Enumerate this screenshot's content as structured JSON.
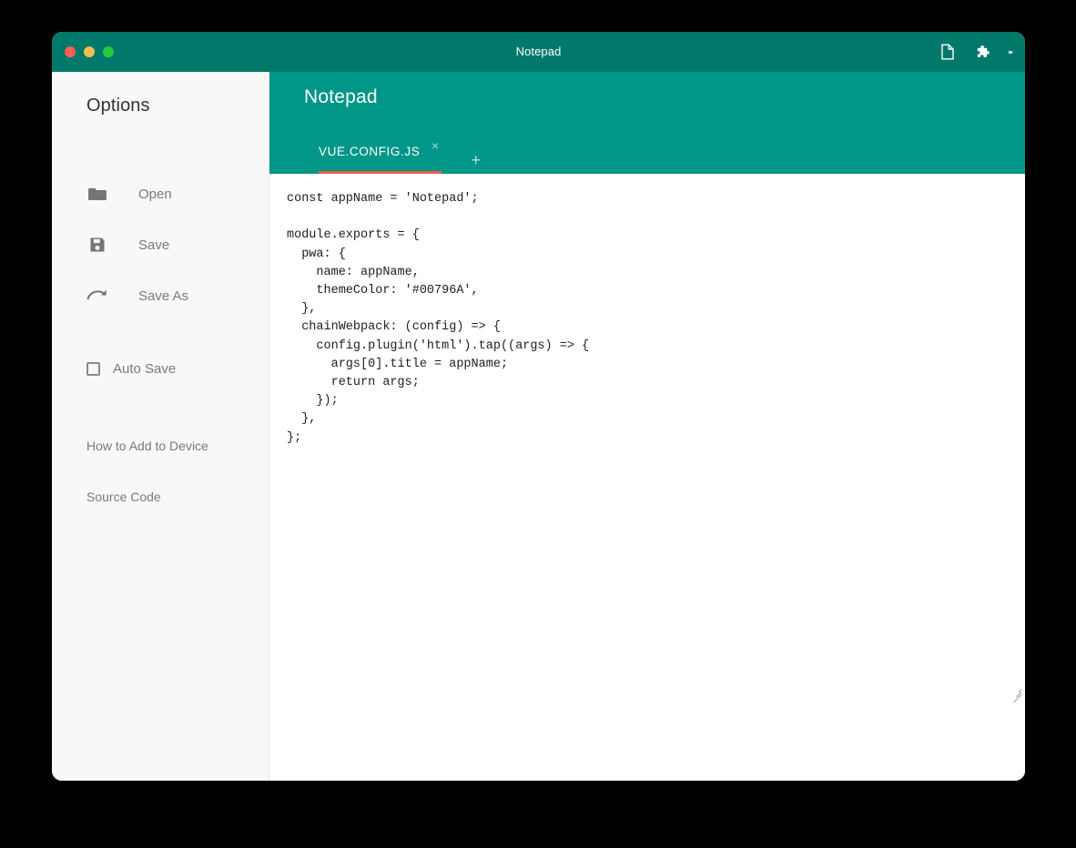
{
  "window": {
    "title": "Notepad",
    "controls": [
      {
        "name": "close",
        "color": "#ff5f56"
      },
      {
        "name": "minimize",
        "color": "#f4bd4f"
      },
      {
        "name": "maximize",
        "color": "#27c93f"
      }
    ],
    "actions": [
      {
        "icon": "page-icon",
        "label": "New page"
      },
      {
        "icon": "puzzle-piece-icon",
        "label": "Extensions"
      },
      {
        "icon": "kebab-menu-icon",
        "label": "More options"
      }
    ]
  },
  "sidebar": {
    "title": "Options",
    "items": [
      {
        "icon": "folder-icon",
        "label": "Open"
      },
      {
        "icon": "save-icon",
        "label": "Save"
      },
      {
        "icon": "redo-arrow-icon",
        "label": "Save As"
      }
    ],
    "auto_save": {
      "label": "Auto Save",
      "checked": false
    },
    "links": [
      {
        "label": "How to Add to Device"
      },
      {
        "label": "Source Code"
      }
    ]
  },
  "app": {
    "title": "Notepad",
    "tabs": [
      {
        "label": "VUE.CONFIG.JS",
        "active": true,
        "close_icon": "×"
      }
    ],
    "add_tab_label": "+",
    "active_tab_indicator_color": "#ef5b4c"
  },
  "editor": {
    "content": "const appName = 'Notepad';\n\nmodule.exports = {\n  pwa: {\n    name: appName,\n    themeColor: '#00796A',\n  },\n  chainWebpack: (config) => {\n    config.plugin('html').tap((args) => {\n      args[0].title = appName;\n      return args;\n    });\n  },\n};",
    "placeholder": ""
  },
  "colors": {
    "titlebar": "#00796A",
    "header": "#009688",
    "accent": "#EF5B4C",
    "sidebar_bg": "#F8F8F8",
    "editor_bg": "#FFFFFF",
    "desktop_bg": "#000000"
  }
}
